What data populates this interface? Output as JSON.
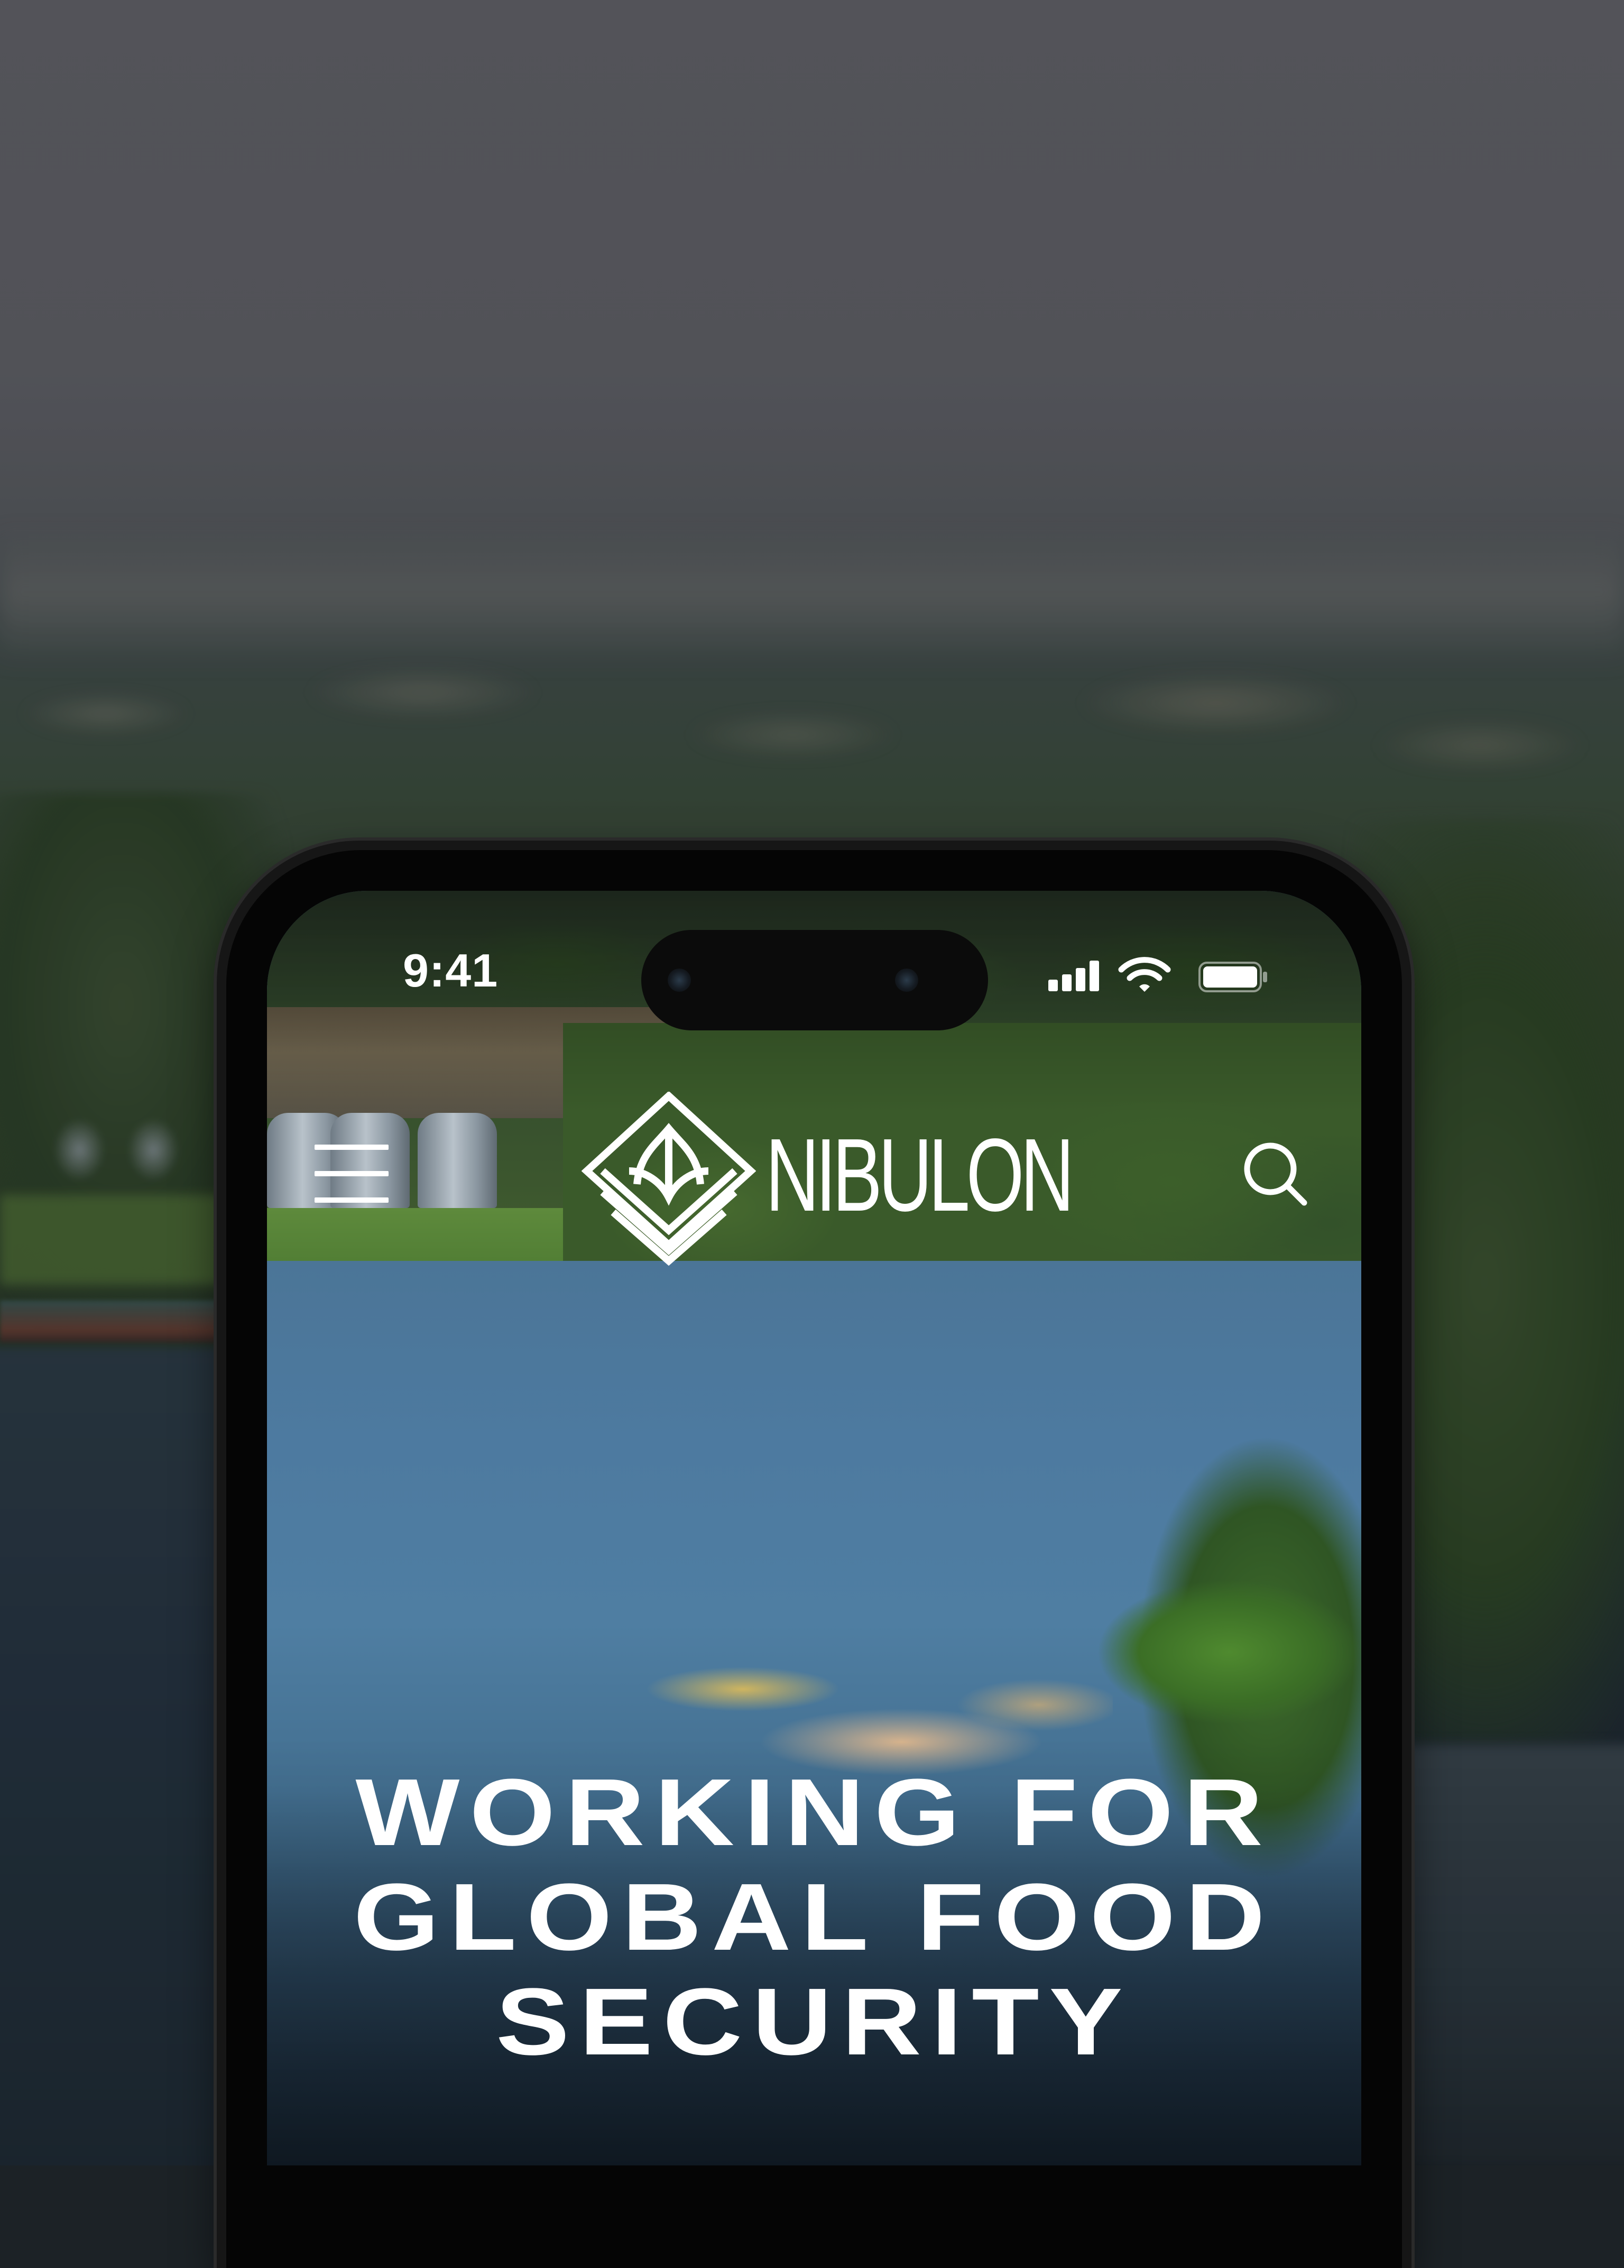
{
  "status_bar": {
    "time": "9:41",
    "icons": [
      "cellular-signal-icon",
      "wifi-icon",
      "battery-icon"
    ]
  },
  "header": {
    "menu_icon": "hamburger-menu-icon",
    "logo_text": "NIBULON",
    "search_icon": "search-icon"
  },
  "hero": {
    "headline_lines": [
      "WORKING FOR",
      "GLOBAL FOOD",
      "SECURITY"
    ]
  },
  "colors": {
    "text": "#ffffff",
    "phone_frame": "#161616",
    "backdrop": "#5f5f66"
  }
}
